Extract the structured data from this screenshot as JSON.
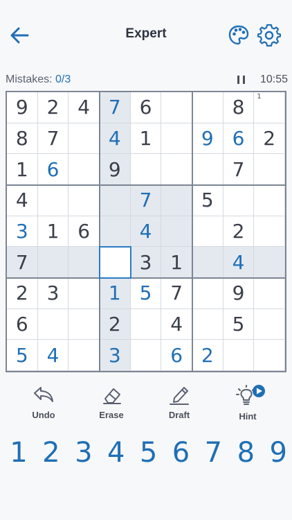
{
  "header": {
    "title": "Expert",
    "back_icon": "back-arrow-icon",
    "theme_icon": "palette-icon",
    "settings_icon": "gear-icon"
  },
  "status": {
    "mistakes_label": "Mistakes:",
    "mistakes_count": "0/3",
    "timer": "10:55",
    "pause_icon": "pause-icon"
  },
  "board": {
    "cells": [
      [
        "9",
        "2",
        "4",
        "7",
        "6",
        "",
        "",
        "8",
        ""
      ],
      [
        "8",
        "7",
        "",
        "4",
        "1",
        "",
        "9",
        "6",
        "2"
      ],
      [
        "1",
        "6",
        "",
        "9",
        "",
        "",
        "",
        "7",
        ""
      ],
      [
        "4",
        "",
        "",
        "",
        "7",
        "",
        "5",
        "",
        ""
      ],
      [
        "3",
        "1",
        "6",
        "",
        "4",
        "",
        "",
        "2",
        ""
      ],
      [
        "7",
        "",
        "",
        "",
        "3",
        "1",
        "",
        "4",
        ""
      ],
      [
        "2",
        "3",
        "",
        "1",
        "5",
        "7",
        "",
        "9",
        ""
      ],
      [
        "6",
        "",
        "",
        "2",
        "",
        "4",
        "",
        "5",
        ""
      ],
      [
        "5",
        "4",
        "",
        "3",
        "",
        "6",
        "2",
        "",
        ""
      ]
    ],
    "user_entries": [
      [
        0,
        3
      ],
      [
        1,
        3
      ],
      [
        1,
        6
      ],
      [
        1,
        7
      ],
      [
        2,
        1
      ],
      [
        3,
        4
      ],
      [
        4,
        0
      ],
      [
        4,
        4
      ],
      [
        5,
        7
      ],
      [
        6,
        3
      ],
      [
        6,
        4
      ],
      [
        8,
        0
      ],
      [
        8,
        1
      ],
      [
        8,
        3
      ],
      [
        8,
        5
      ],
      [
        8,
        6
      ]
    ],
    "notes": [
      {
        "row": 0,
        "col": 8,
        "text": "1"
      }
    ],
    "selected": {
      "row": 5,
      "col": 3
    }
  },
  "tools": [
    {
      "label": "Undo",
      "icon": "undo-icon"
    },
    {
      "label": "Erase",
      "icon": "eraser-icon"
    },
    {
      "label": "Draft",
      "icon": "pencil-icon"
    },
    {
      "label": "Hint",
      "icon": "lightbulb-icon"
    }
  ],
  "numpad": [
    "1",
    "2",
    "3",
    "4",
    "5",
    "6",
    "7",
    "8",
    "9"
  ],
  "colors": {
    "accent": "#1f6fb5",
    "given_digit": "#3a3f4a",
    "highlight": "#e4e8ef",
    "background": "#f7f8fa",
    "grid_thick": "#7c8594",
    "grid_thin": "#d4d9e0"
  }
}
